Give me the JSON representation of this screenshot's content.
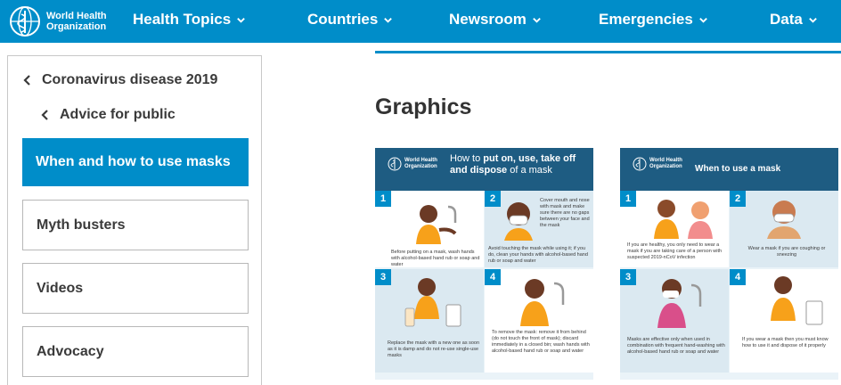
{
  "brand": {
    "line1": "World Health",
    "line2": "Organization",
    "primary_color": "#008dc9",
    "dark_color": "#1e5c82"
  },
  "nav": {
    "items": [
      {
        "label": "Health Topics"
      },
      {
        "label": "Countries"
      },
      {
        "label": "Newsroom"
      },
      {
        "label": "Emergencies"
      },
      {
        "label": "Data"
      }
    ]
  },
  "sidebar": {
    "breadcrumb_parent": "Coronavirus disease 2019",
    "breadcrumb_child": "Advice for public",
    "active": "When and how to use masks",
    "links": [
      "Myth busters",
      "Videos",
      "Advocacy"
    ]
  },
  "main": {
    "title": "Graphics",
    "cards": [
      {
        "org_line1": "World Health",
        "org_line2": "Organization",
        "title_pre": "How to ",
        "title_bold": "put on, use, take off and dispose",
        "title_post": " of a mask",
        "panels": [
          {
            "num": "1",
            "caption": "Before putting on a mask, wash hands with alcohol-based hand rub or soap and water"
          },
          {
            "num": "2",
            "caption": "Cover mouth and nose with mask and make sure there are no gaps between your face and the mask"
          },
          {
            "num": "",
            "caption": "Avoid touching the mask while using it; if you do, clean your hands with alcohol-based hand rub or soap and water"
          },
          {
            "num": "3",
            "caption": "Replace the mask with a new one as soon as it is damp and do not re-use single-use masks"
          },
          {
            "num": "4",
            "caption": "To remove the mask: remove it from behind (do not touch the front of mask); discard immediately in a closed bin; wash hands with alcohol-based hand rub or soap and water"
          }
        ]
      },
      {
        "org_line1": "World Health",
        "org_line2": "Organization",
        "title": "When to use a mask",
        "panels": [
          {
            "num": "1",
            "caption": "If you are healthy, you only need to wear a mask if you are taking care of a person with suspected 2019-nCoV infection"
          },
          {
            "num": "2",
            "caption": "Wear a mask if you are coughing or sneezing"
          },
          {
            "num": "3",
            "caption": "Masks are effective only when used in combination with frequent hand-washing with alcohol-based hand rub or soap and water"
          },
          {
            "num": "4",
            "caption": "If you wear a mask then you must know how to use it and dispose of it properly"
          }
        ]
      }
    ]
  }
}
